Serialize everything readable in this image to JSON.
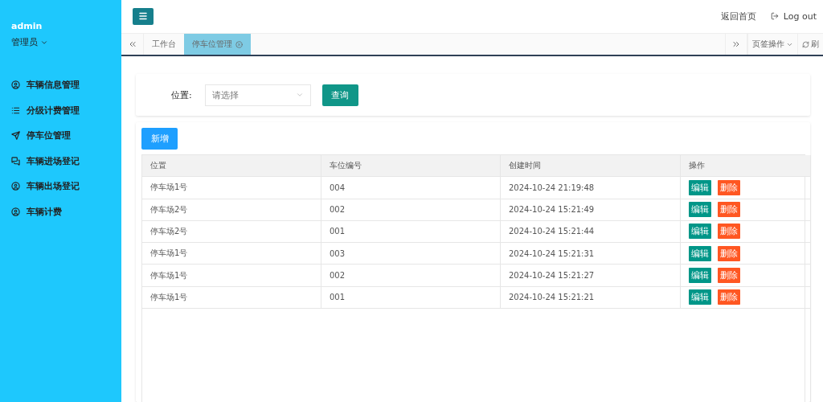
{
  "sidebar": {
    "user": "admin",
    "role": "管理员",
    "items": [
      {
        "label": "车辆信息管理"
      },
      {
        "label": "分级计费管理"
      },
      {
        "label": "停车位管理"
      },
      {
        "label": "车辆进场登记"
      },
      {
        "label": "车辆出场登记"
      },
      {
        "label": "车辆计费"
      }
    ]
  },
  "header": {
    "home_link": "返回首页",
    "logout": "Log out"
  },
  "tabs": [
    {
      "label": "工作台",
      "selected": false,
      "closable": false
    },
    {
      "label": "停车位管理",
      "selected": true,
      "closable": true
    }
  ],
  "tab_tools": {
    "page_ops": "页签操作",
    "refresh": "刷"
  },
  "search": {
    "label": "位置:",
    "placeholder": "请选择",
    "button": "查询"
  },
  "add_button": "新增",
  "table": {
    "columns": [
      "位置",
      "车位编号",
      "创建时间",
      "操作"
    ],
    "rows": [
      {
        "location": "停车场1号",
        "number": "004",
        "created": "2024-10-24 21:19:48",
        "actions": [
          "编辑",
          "删除"
        ]
      },
      {
        "location": "停车场2号",
        "number": "002",
        "created": "2024-10-24 15:21:49",
        "actions": [
          "编辑",
          "删除"
        ]
      },
      {
        "location": "停车场2号",
        "number": "001",
        "created": "2024-10-24 15:21:44",
        "actions": [
          "编辑",
          "删除"
        ]
      },
      {
        "location": "停车场1号",
        "number": "003",
        "created": "2024-10-24 15:21:31",
        "actions": [
          "编辑",
          "删除"
        ]
      },
      {
        "location": "停车场1号",
        "number": "002",
        "created": "2024-10-24 15:21:27",
        "actions": [
          "编辑",
          "删除"
        ]
      },
      {
        "location": "停车场1号",
        "number": "001",
        "created": "2024-10-24 15:21:21",
        "actions": [
          "编辑",
          "删除"
        ]
      }
    ]
  }
}
